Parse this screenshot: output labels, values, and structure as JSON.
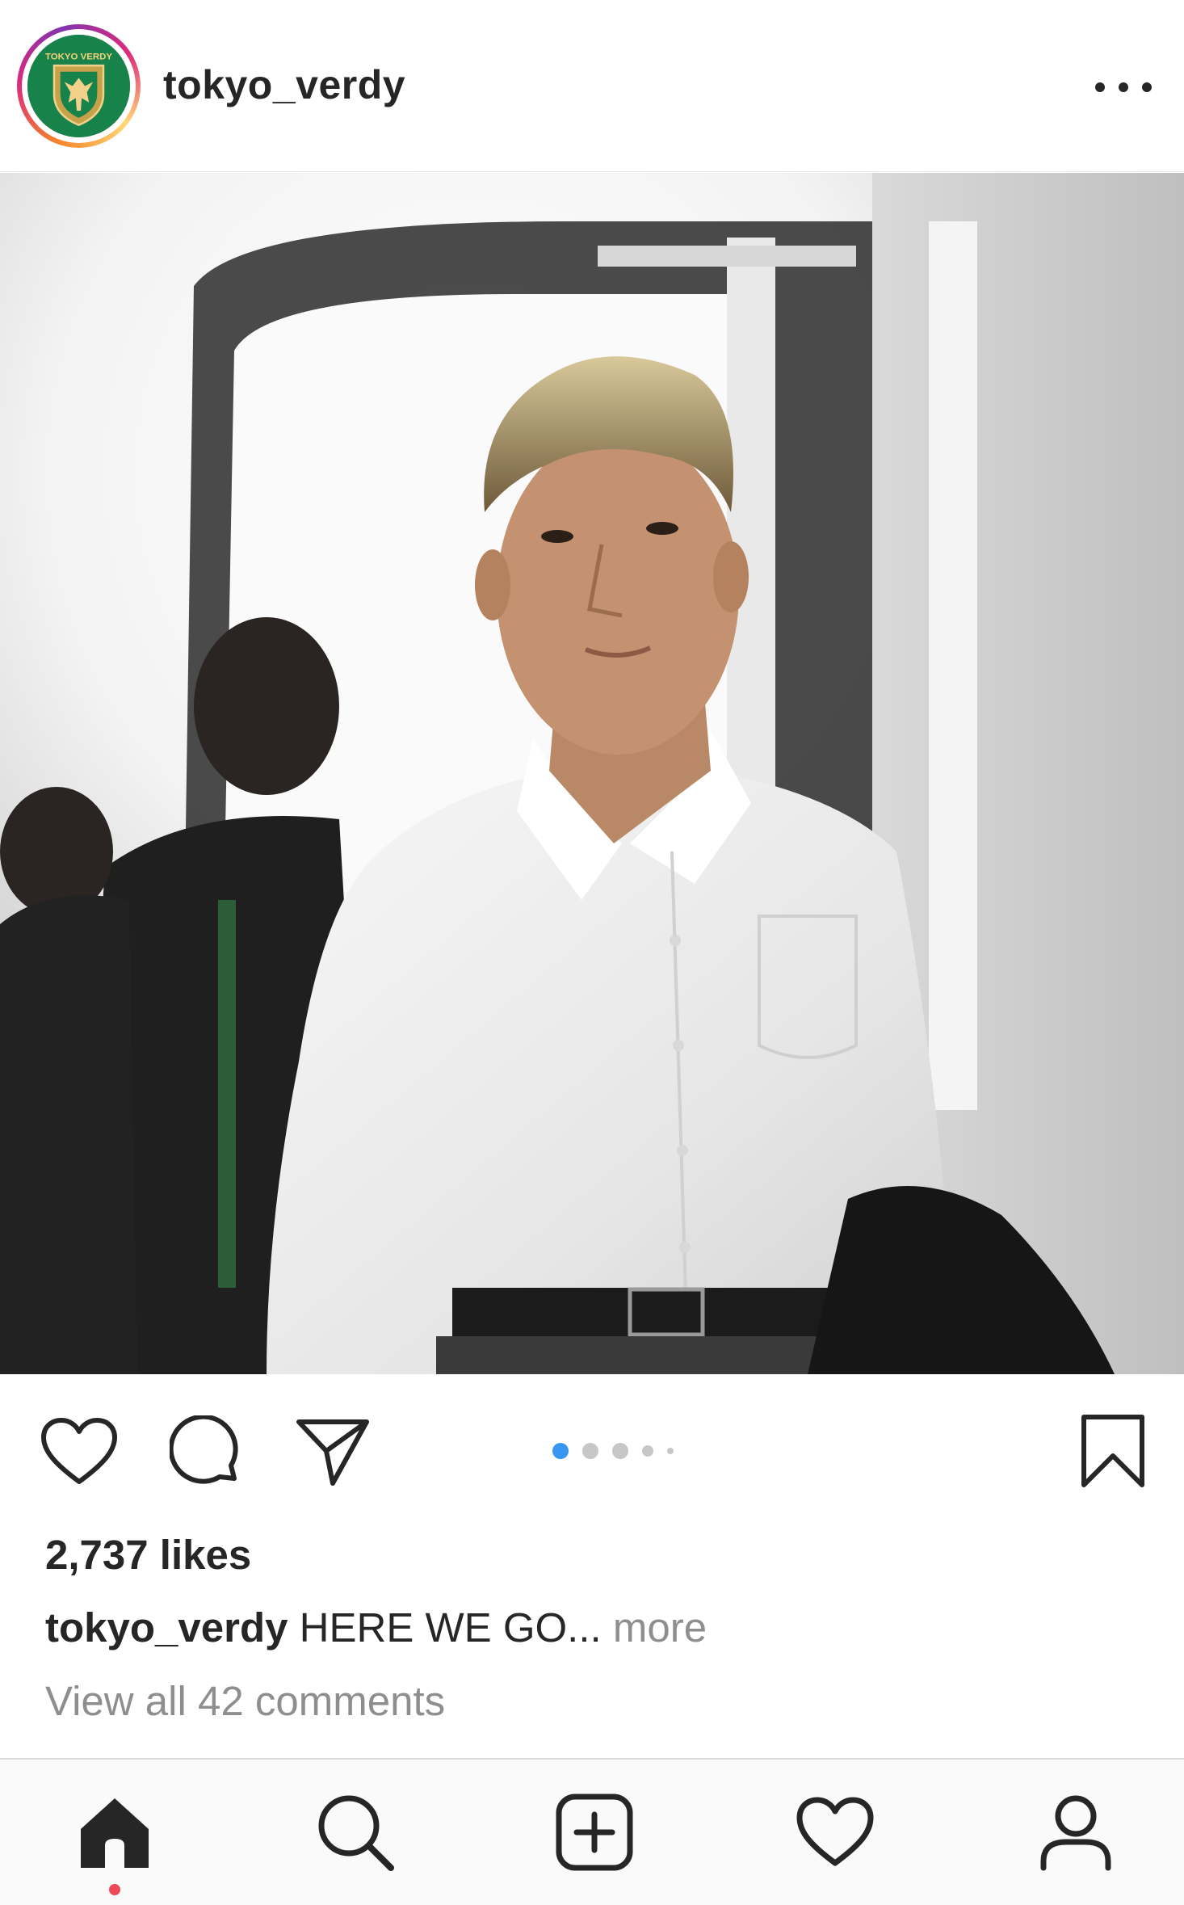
{
  "post": {
    "username": "tokyo_verdy",
    "avatar_text": "TOKYO VERDY",
    "avatar_icon": "club-crest-icon",
    "more_icon": "more-options-icon"
  },
  "carousel": {
    "current": 1,
    "total": 5,
    "active_color": "#3897f0"
  },
  "actions": {
    "like_icon": "heart-icon",
    "comment_icon": "comment-icon",
    "share_icon": "paper-plane-icon",
    "save_icon": "bookmark-icon"
  },
  "likes_text": "2,737 likes",
  "caption": {
    "username": "tokyo_verdy",
    "text": "HERE WE GO...",
    "more_label": "more"
  },
  "comments_link": "View all 42 comments",
  "tabbar": {
    "items": [
      {
        "icon": "home-icon",
        "active": true
      },
      {
        "icon": "search-icon",
        "active": false
      },
      {
        "icon": "new-post-icon",
        "active": false
      },
      {
        "icon": "activity-heart-icon",
        "active": false
      },
      {
        "icon": "profile-icon",
        "active": false
      }
    ],
    "notification_color": "#ed4956"
  },
  "colors": {
    "text": "#262626",
    "secondary_text": "#8e8e8e",
    "club_green": "#17824a"
  }
}
